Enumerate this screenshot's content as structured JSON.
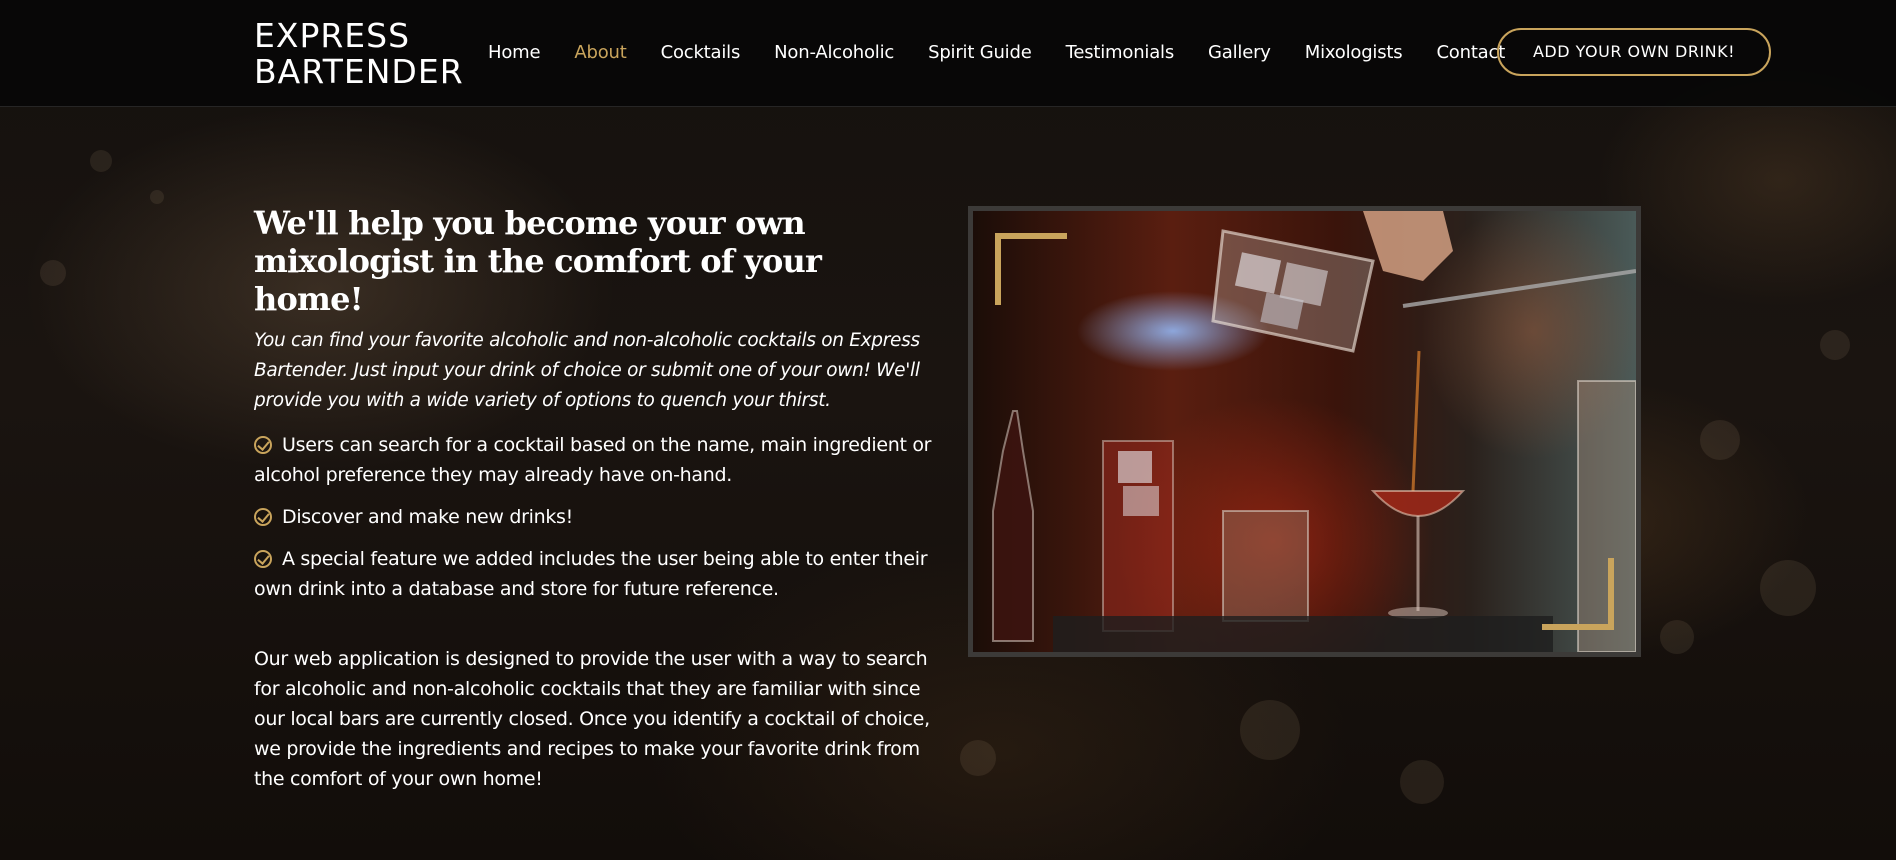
{
  "header": {
    "logo_line1": "EXPRESS",
    "logo_line2": "BARTENDER",
    "nav": [
      {
        "label": "Home"
      },
      {
        "label": "About"
      },
      {
        "label": "Cocktails"
      },
      {
        "label": "Non-Alcoholic"
      },
      {
        "label": "Spirit Guide"
      },
      {
        "label": "Testimonials"
      },
      {
        "label": "Gallery"
      },
      {
        "label": "Mixologists"
      },
      {
        "label": "Contact"
      }
    ],
    "active_nav": "About",
    "cta_label": "ADD YOUR OWN DRINK!"
  },
  "about": {
    "heading": "We'll help you become your own mixologist in the comfort of your home!",
    "intro": "You can find your favorite alcoholic and non-alcoholic cocktails on Express Bartender. Just input your drink of choice or submit one of your own! We'll provide you with a wide variety of options to quench your thirst.",
    "features": [
      "Users can search for a cocktail based on the name, main ingredient or alcohol preference they may already have on-hand.",
      "Discover and make new drinks!",
      "A special feature we added includes the user being able to enter their own drink into a database and store for future reference."
    ],
    "description": "Our web application is designed to provide the user with a way to search for alcoholic and non-alcoholic cocktails that they are familiar with since our local bars are currently closed. Once you identify a cocktail of choice, we provide the ingredients and recipes to make your favorite drink from the comfort of your own home!"
  },
  "icons": {
    "feature_bullet": "check-circle-icon",
    "accent_color": "#c9a45c"
  }
}
